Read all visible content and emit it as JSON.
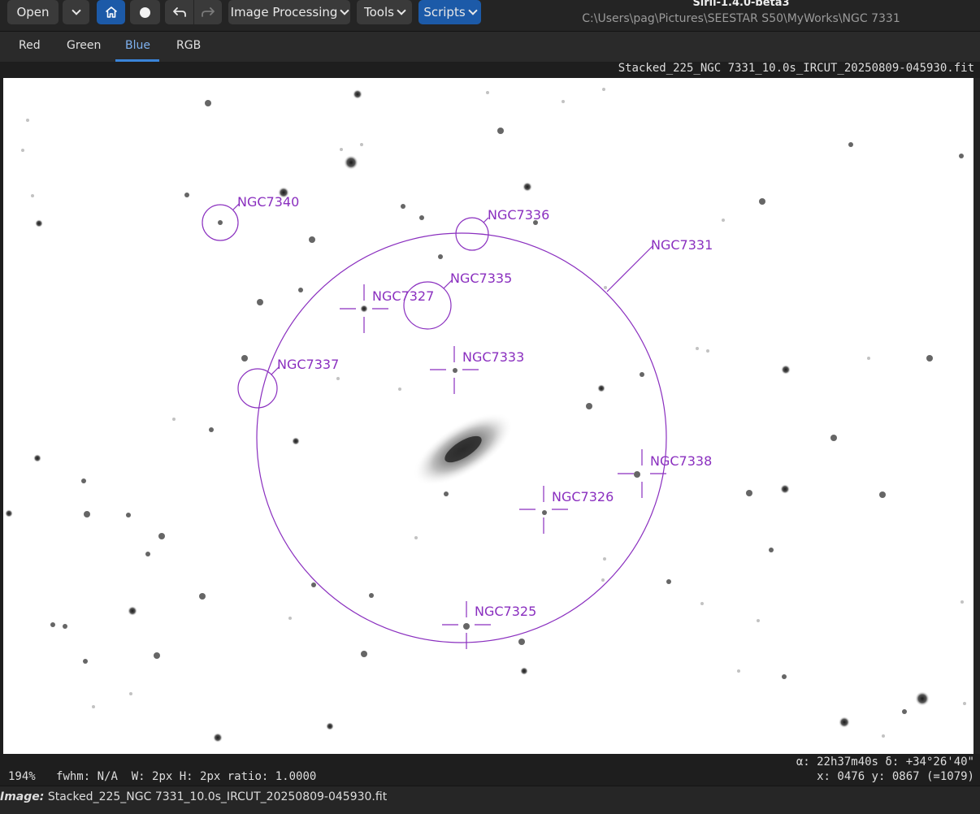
{
  "window": {
    "title": "Siril-1.4.0-beta3",
    "path": "C:\\Users\\pag\\Pictures\\SEESTAR S50\\MyWorks\\NGC 7331"
  },
  "toolbar": {
    "open_label": "Open",
    "image_processing_label": "Image Processing",
    "tools_label": "Tools",
    "scripts_label": "Scripts"
  },
  "tabs": [
    {
      "label": "Red"
    },
    {
      "label": "Green"
    },
    {
      "label": "Blue",
      "active": true
    },
    {
      "label": "RGB"
    }
  ],
  "image": {
    "filename": "Stacked_225_NGC 7331_10.0s_IRCUT_20250809-045930.fit",
    "annotations": [
      {
        "label": "NGC7340",
        "marker": "circle"
      },
      {
        "label": "NGC7336",
        "marker": "circle"
      },
      {
        "label": "NGC7331",
        "marker": "circle"
      },
      {
        "label": "NGC7335",
        "marker": "circle"
      },
      {
        "label": "NGC7327",
        "marker": "cross"
      },
      {
        "label": "NGC7333",
        "marker": "cross"
      },
      {
        "label": "NGC7337",
        "marker": "circle"
      },
      {
        "label": "NGC7338",
        "marker": "cross"
      },
      {
        "label": "NGC7326",
        "marker": "cross"
      },
      {
        "label": "NGC7325",
        "marker": "cross"
      }
    ]
  },
  "status": {
    "zoom": "194%",
    "fwhm": "fwhm: N/A",
    "size": "W: 2px H: 2px ratio: 1.0000",
    "ra_dec": "α: 22h37m40s δ: +34°26'40\"",
    "coords": "x: 0476 y: 0867 (=1079)"
  },
  "bottom": {
    "prefix": "Image:",
    "filename": "Stacked_225_NGC 7331_10.0s_IRCUT_20250809-045930.fit"
  },
  "colors": {
    "accent": "#1c5aa8",
    "annotation": "#8a2fbf",
    "tab_active": "#7eb1ef"
  }
}
